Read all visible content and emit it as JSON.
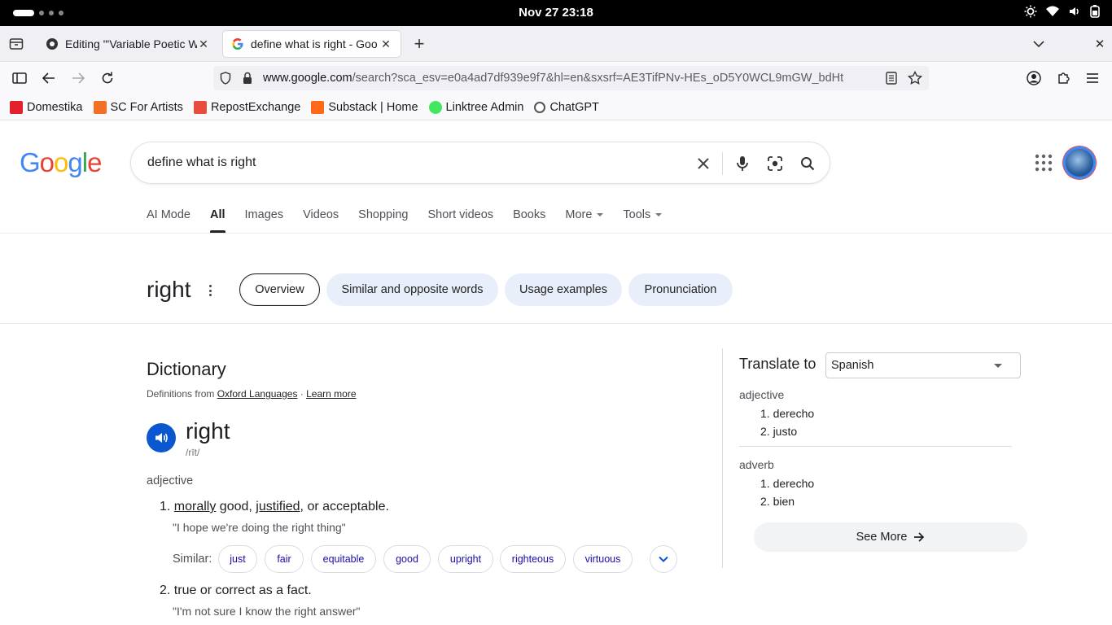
{
  "os": {
    "clock": "Nov 27  23:18"
  },
  "browser": {
    "tabs": [
      {
        "title": "Editing \"'Variable Poetic W"
      },
      {
        "title": "define what is right - Goo"
      }
    ],
    "url_host": "www.google.com",
    "url_rest": "/search?sca_esv=e0a4ad7df939e9f7&hl=en&sxsrf=AE3TifPNv-HEs_oD5Y0WCL9mGW_bdHt",
    "bookmarks": [
      {
        "label": "Domestika",
        "color": "#e5202e"
      },
      {
        "label": "SC For Artists",
        "color": "#f26f23"
      },
      {
        "label": "RepostExchange",
        "color": "#e74c3c"
      },
      {
        "label": "Substack | Home",
        "color": "#ff6719"
      },
      {
        "label": "Linktree Admin",
        "color": "#43e660"
      },
      {
        "label": "ChatGPT",
        "color": "#555555"
      }
    ]
  },
  "google": {
    "query": "define what is right",
    "tabs": [
      "AI Mode",
      "All",
      "Images",
      "Videos",
      "Shopping",
      "Short videos",
      "Books",
      "More",
      "Tools"
    ],
    "word": "right",
    "chips": [
      "Overview",
      "Similar and opposite words",
      "Usage examples",
      "Pronunciation"
    ]
  },
  "dictionary": {
    "title": "Dictionary",
    "source_prefix": "Definitions from ",
    "source_link": "Oxford Languages",
    "source_sep": " · ",
    "learn_more": "Learn more",
    "headword": "right",
    "phonetic": "/rīt/",
    "pos": "adjective",
    "def1_num": "1.",
    "def1_w1": "morally",
    "def1_t1": " good, ",
    "def1_w2": "justified",
    "def1_t2": ", or acceptable.",
    "ex1": "\"I hope we're doing the right thing\"",
    "similar_label": "Similar:",
    "synonyms": [
      "just",
      "fair",
      "equitable",
      "good",
      "upright",
      "righteous",
      "virtuous"
    ],
    "def2_num": "2.",
    "def2": "true or correct as a fact.",
    "ex2": "\"I'm not sure I know the right answer\""
  },
  "translate": {
    "label": "Translate to",
    "language": "Spanish",
    "groups": [
      {
        "pos": "adjective",
        "items": [
          "1. derecho",
          "2. justo"
        ]
      },
      {
        "pos": "adverb",
        "items": [
          "1. derecho",
          "2. bien"
        ]
      }
    ],
    "see_more": "See More"
  }
}
